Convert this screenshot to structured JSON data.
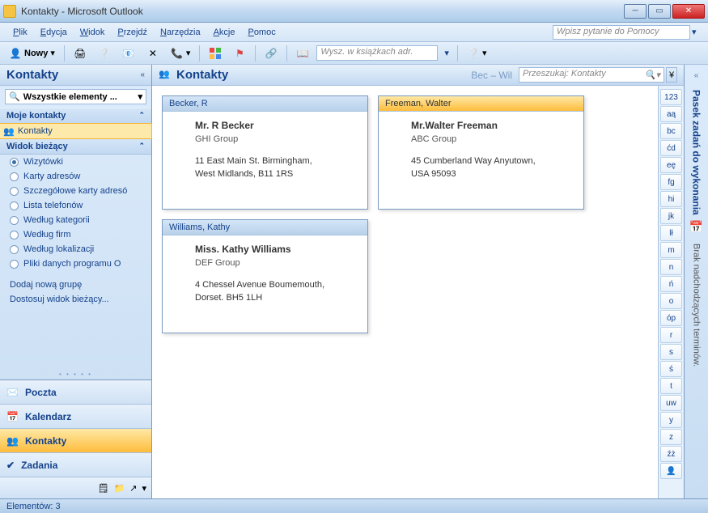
{
  "window": {
    "title": "Kontakty - Microsoft Outlook"
  },
  "menus": [
    "Plik",
    "Edycja",
    "Widok",
    "Przejdź",
    "Narzędzia",
    "Akcje",
    "Pomoc"
  ],
  "help_placeholder": "Wpisz pytanie do Pomocy",
  "toolbar": {
    "new_label": "Nowy",
    "search_placeholder": "Wysz. w książkach adr."
  },
  "leftpane": {
    "title": "Kontakty",
    "searchbox": "Wszystkie elementy ...",
    "section_my": "Moje kontakty",
    "my_items": [
      "Kontakty"
    ],
    "section_view": "Widok bieżący",
    "views": [
      {
        "label": "Wizytówki",
        "selected": true
      },
      {
        "label": "Karty adresów",
        "selected": false
      },
      {
        "label": "Szczegółowe karty adresó",
        "selected": false
      },
      {
        "label": "Lista telefonów",
        "selected": false
      },
      {
        "label": "Według kategorii",
        "selected": false
      },
      {
        "label": "Według firm",
        "selected": false
      },
      {
        "label": "Według lokalizacji",
        "selected": false
      },
      {
        "label": "Pliki danych programu O",
        "selected": false
      }
    ],
    "link_add": "Dodaj nową grupę",
    "link_custom": "Dostosuj widok bieżący...",
    "nav": [
      {
        "label": "Poczta",
        "icon": "mail-icon"
      },
      {
        "label": "Kalendarz",
        "icon": "calendar-icon"
      },
      {
        "label": "Kontakty",
        "icon": "contacts-icon"
      },
      {
        "label": "Zadania",
        "icon": "tasks-icon"
      }
    ],
    "nav_active_index": 2
  },
  "center": {
    "title": "Kontakty",
    "range": "Bec – Wil",
    "search_placeholder": "Przeszukaj: Kontakty",
    "contacts": [
      {
        "sort": "Becker, R",
        "name": "Mr. R Becker",
        "group": "GHI Group",
        "addr1": "11 East Main St. Birmingham,",
        "addr2": "West Midlands, B11 1RS",
        "selected": false
      },
      {
        "sort": "Freeman, Walter",
        "name": "Mr.Walter Freeman",
        "group": "ABC Group",
        "addr1": "45 Cumberland Way Anyutown,",
        "addr2": "USA 95093",
        "selected": true
      },
      {
        "sort": "Williams, Kathy",
        "name": "Miss. Kathy Williams",
        "group": "DEF Group",
        "addr1": "4 Chessel Avenue Boumemouth,",
        "addr2": "Dorset. BH5 1LH",
        "selected": false
      }
    ]
  },
  "alpha": [
    "123",
    "aą",
    "bc",
    "ćd",
    "eę",
    "fg",
    "hi",
    "jk",
    "lł",
    "m",
    "n",
    "ń",
    "o",
    "óp",
    "r",
    "s",
    "ś",
    "t",
    "uw",
    "y",
    "z",
    "źż"
  ],
  "rightbar": {
    "title": "Pasek zadań do wykonania",
    "note": "Brak nadchodzących terminów."
  },
  "statusbar": {
    "count_label": "Elementów: 3"
  }
}
